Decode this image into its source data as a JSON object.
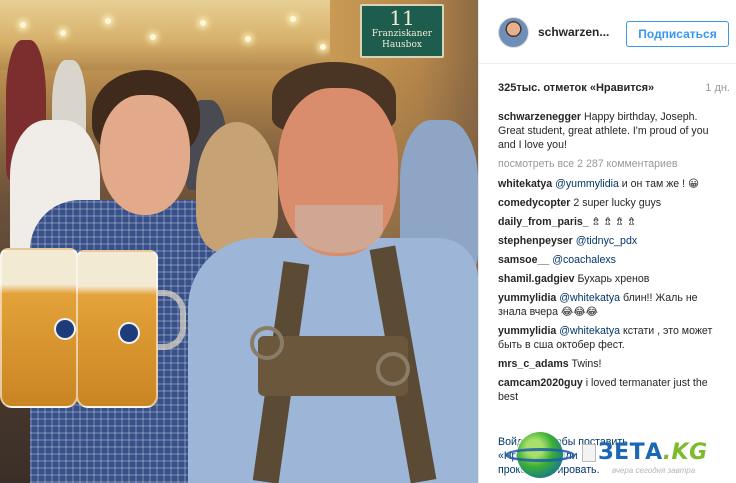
{
  "photo": {
    "sign": {
      "number": "11",
      "line1": "Franziskaner",
      "line2": "Hausbox"
    }
  },
  "post": {
    "username": "schwarzen...",
    "follow_label": "Подписаться",
    "likes": "325тыс. отметок «Нравится»",
    "age": "1 дн.",
    "caption_user": "schwarzenegger",
    "caption_text": "Happy birthday, Joseph. Great student, great athlete. I'm proud of you and I love you!",
    "view_all": "посмотреть все 2 287 комментариев",
    "comments": [
      {
        "user": "whitekatya",
        "mention": "@yummylidia",
        "text": " и он там же ! 😀"
      },
      {
        "user": "comedycopter",
        "mention": "",
        "text": " 2 super lucky guys"
      },
      {
        "user": "daily_from_paris_",
        "mention": "",
        "text": " ⇯ ⇯ ⇯ ⇯"
      },
      {
        "user": "stephenpeyser",
        "mention": "@tidnyc_pdx",
        "text": ""
      },
      {
        "user": "samsoe__",
        "mention": "@coachalexs",
        "text": ""
      },
      {
        "user": "shamil.gadgiev",
        "mention": "",
        "text": " Бухарь хренов"
      },
      {
        "user": "yummylidia",
        "mention": "@whitekatya",
        "text": " блин!! Жаль не знала вчера 😂😂😂"
      },
      {
        "user": "yummylidia",
        "mention": "@whitekatya",
        "text": " кстати , это может быть в сша октобер фест."
      },
      {
        "user": "mrs_c_adams",
        "mention": "",
        "text": " Twins!"
      },
      {
        "user": "camcam2020guy",
        "mention": "",
        "text": " i loved termanater just the best"
      }
    ],
    "footer_line1": "Войдите, чтобы поставить",
    "footer_line2": "«Нравится» или",
    "footer_line3": "прокомментировать."
  },
  "watermark": {
    "brand": "ЗЕТА",
    "domain": ".KG",
    "tagline": "вчера сегодня завтра"
  }
}
